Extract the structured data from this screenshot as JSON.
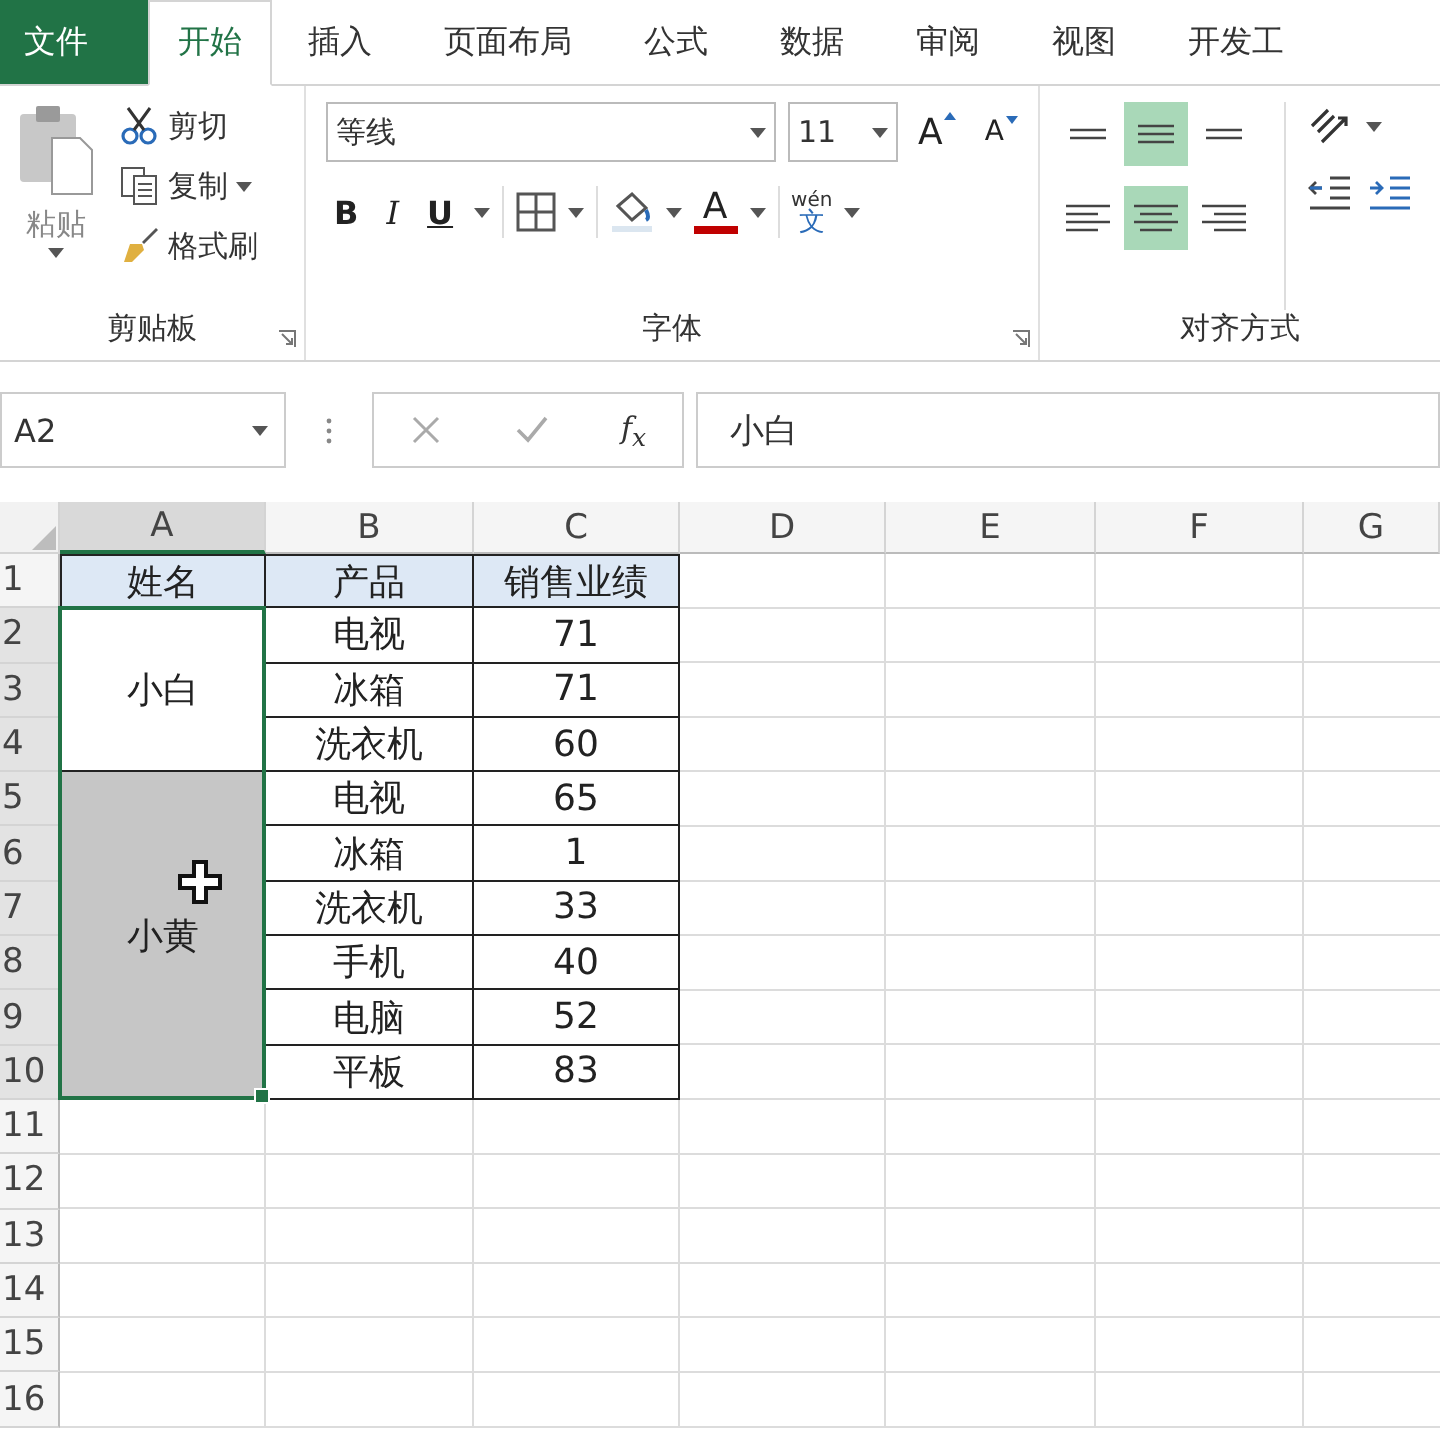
{
  "tabs": [
    {
      "label": "文件",
      "kind": "file",
      "selected": false
    },
    {
      "label": "开始",
      "kind": "tab",
      "selected": true
    },
    {
      "label": "插入",
      "kind": "tab",
      "selected": false
    },
    {
      "label": "页面布局",
      "kind": "tab",
      "selected": false
    },
    {
      "label": "公式",
      "kind": "tab",
      "selected": false
    },
    {
      "label": "数据",
      "kind": "tab",
      "selected": false
    },
    {
      "label": "审阅",
      "kind": "tab",
      "selected": false
    },
    {
      "label": "视图",
      "kind": "tab",
      "selected": false
    },
    {
      "label": "开发工",
      "kind": "tab",
      "selected": false
    }
  ],
  "clipboard": {
    "paste": "粘贴",
    "cut": "剪切",
    "copy": "复制",
    "painter": "格式刷",
    "group_label": "剪贴板"
  },
  "font": {
    "name": "等线",
    "size": "11",
    "grow": "A",
    "shrink": "A",
    "bold": "B",
    "italic": "I",
    "underline": "U",
    "color_letter": "A",
    "phonetic_top": "wén",
    "phonetic_bottom": "文",
    "group_label": "字体"
  },
  "alignment": {
    "group_label": "对齐方式",
    "buttons": [
      {
        "kind": "top",
        "selected": false
      },
      {
        "kind": "middle",
        "selected": true
      },
      {
        "kind": "bottom",
        "selected": false
      },
      {
        "kind": "left",
        "selected": false
      },
      {
        "kind": "center",
        "selected": true
      },
      {
        "kind": "right",
        "selected": false
      }
    ]
  },
  "formula_bar": {
    "name_box": "A2",
    "function_label": "f$_{x}$",
    "value": "小白"
  },
  "sheet": {
    "columns": [
      {
        "label": "A",
        "selected": true
      },
      {
        "label": "B",
        "selected": false
      },
      {
        "label": "C",
        "selected": false
      },
      {
        "label": "D",
        "selected": false
      },
      {
        "label": "E",
        "selected": false
      },
      {
        "label": "F",
        "selected": false
      },
      {
        "label": "G",
        "selected": false
      }
    ],
    "rows": [
      {
        "label": "1",
        "selected": false
      },
      {
        "label": "2",
        "selected": true
      },
      {
        "label": "3",
        "selected": true
      },
      {
        "label": "4",
        "selected": true
      },
      {
        "label": "5",
        "selected": true
      },
      {
        "label": "6",
        "selected": true
      },
      {
        "label": "7",
        "selected": true
      },
      {
        "label": "8",
        "selected": true
      },
      {
        "label": "9",
        "selected": true
      },
      {
        "label": "10",
        "selected": true
      },
      {
        "label": "11",
        "selected": false
      },
      {
        "label": "12",
        "selected": false
      },
      {
        "label": "13",
        "selected": false
      },
      {
        "label": "14",
        "selected": false
      },
      {
        "label": "15",
        "selected": false
      },
      {
        "label": "16",
        "selected": false
      }
    ],
    "headers": [
      "姓名",
      "产品",
      "销售业绩"
    ],
    "groups": [
      {
        "name": "小白",
        "selected": false,
        "records": [
          {
            "product": "电视",
            "sales": "71"
          },
          {
            "product": "冰箱",
            "sales": "71"
          },
          {
            "product": "洗衣机",
            "sales": "60"
          }
        ]
      },
      {
        "name": "小黄",
        "selected": true,
        "records": [
          {
            "product": "电视",
            "sales": "65"
          },
          {
            "product": "冰箱",
            "sales": "1"
          },
          {
            "product": "洗衣机",
            "sales": "33"
          },
          {
            "product": "手机",
            "sales": "40"
          },
          {
            "product": "电脑",
            "sales": "52"
          },
          {
            "product": "平板",
            "sales": "83"
          }
        ]
      }
    ]
  }
}
